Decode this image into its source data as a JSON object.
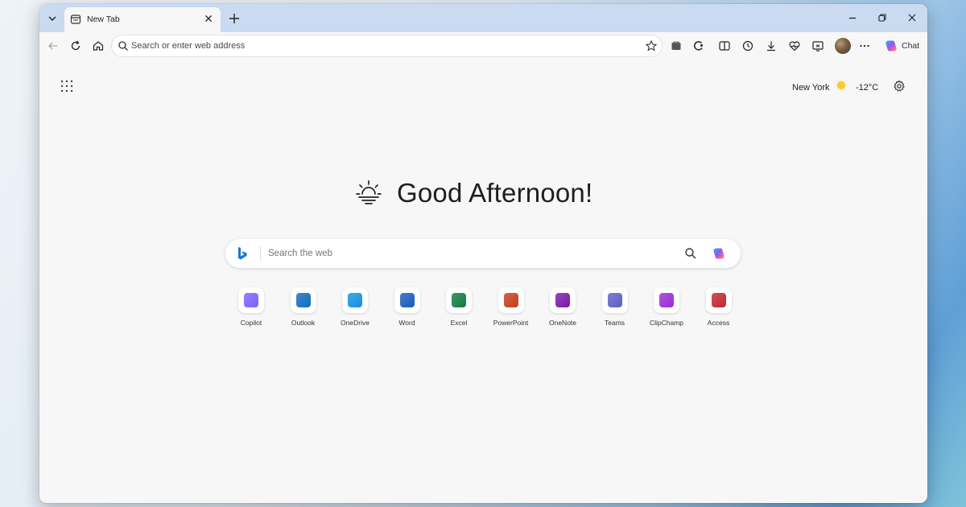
{
  "browser": {
    "tab": {
      "title": "New Tab"
    },
    "address_bar": {
      "placeholder": "Search or enter web address"
    },
    "chat_label": "Chat"
  },
  "new_tab_page": {
    "weather": {
      "city": "New York",
      "temperature": "-12°C"
    },
    "greeting": "Good Afternoon!",
    "search": {
      "placeholder": "Search the web"
    },
    "apps": [
      {
        "label": "Copilot",
        "color": "#7b61ff"
      },
      {
        "label": "Outlook",
        "color": "#0f6cbd"
      },
      {
        "label": "OneDrive",
        "color": "#1490df"
      },
      {
        "label": "Word",
        "color": "#185abd"
      },
      {
        "label": "Excel",
        "color": "#107c41"
      },
      {
        "label": "PowerPoint",
        "color": "#c43e1c"
      },
      {
        "label": "OneNote",
        "color": "#7719aa"
      },
      {
        "label": "Teams",
        "color": "#5b5fc7"
      },
      {
        "label": "ClipChamp",
        "color": "#9b2bd6"
      },
      {
        "label": "Access",
        "color": "#c0272d"
      }
    ]
  }
}
